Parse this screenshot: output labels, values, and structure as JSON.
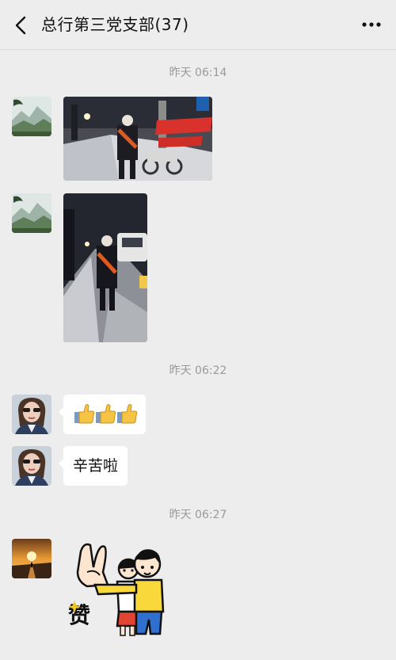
{
  "header": {
    "title": "总行第三党支部(37)"
  },
  "messages": {
    "time1": "昨天 06:14",
    "time2": "昨天 06:22",
    "time3": "昨天 06:27",
    "text_reply": "辛苦啦",
    "thumbs_count": 3,
    "sticker_text": "赞"
  }
}
